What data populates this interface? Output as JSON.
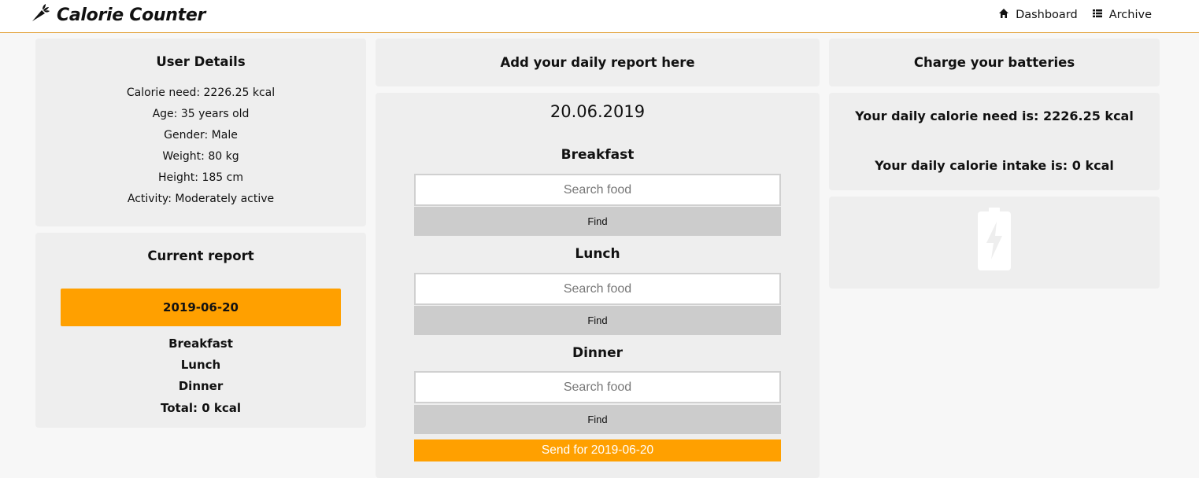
{
  "app": {
    "title": "Calorie Counter",
    "logo_icon": "carrot-icon",
    "nav": [
      {
        "label": "Dashboard",
        "icon": "home-icon"
      },
      {
        "label": "Archive",
        "icon": "list-icon"
      }
    ],
    "accent_color": "#ffa000"
  },
  "user_details": {
    "heading": "User Details",
    "calorie_need": "Calorie need: 2226.25 kcal",
    "age": "Age: 35 years old",
    "gender": "Gender: Male",
    "weight": "Weight: 80 kg",
    "height": "Height: 185 cm",
    "activity": "Activity: Moderately active"
  },
  "current_report": {
    "heading": "Current report",
    "date": "2019-06-20",
    "meals": [
      "Breakfast",
      "Lunch",
      "Dinner"
    ],
    "total": "Total: 0 kcal"
  },
  "daily_report": {
    "heading": "Add your daily report here",
    "date": "20.06.2019",
    "meals": [
      {
        "title": "Breakfast",
        "placeholder": "Search food",
        "value": "",
        "button": "Find"
      },
      {
        "title": "Lunch",
        "placeholder": "Search food",
        "value": "",
        "button": "Find"
      },
      {
        "title": "Dinner",
        "placeholder": "Search food",
        "value": "",
        "button": "Find"
      }
    ],
    "send_label": "Send for 2019-06-20"
  },
  "charge": {
    "heading": "Charge your batteries",
    "need": "Your daily calorie need is: 2226.25 kcal",
    "intake": "Your daily calorie intake is: 0 kcal",
    "battery_icon": "battery-charging-icon"
  }
}
